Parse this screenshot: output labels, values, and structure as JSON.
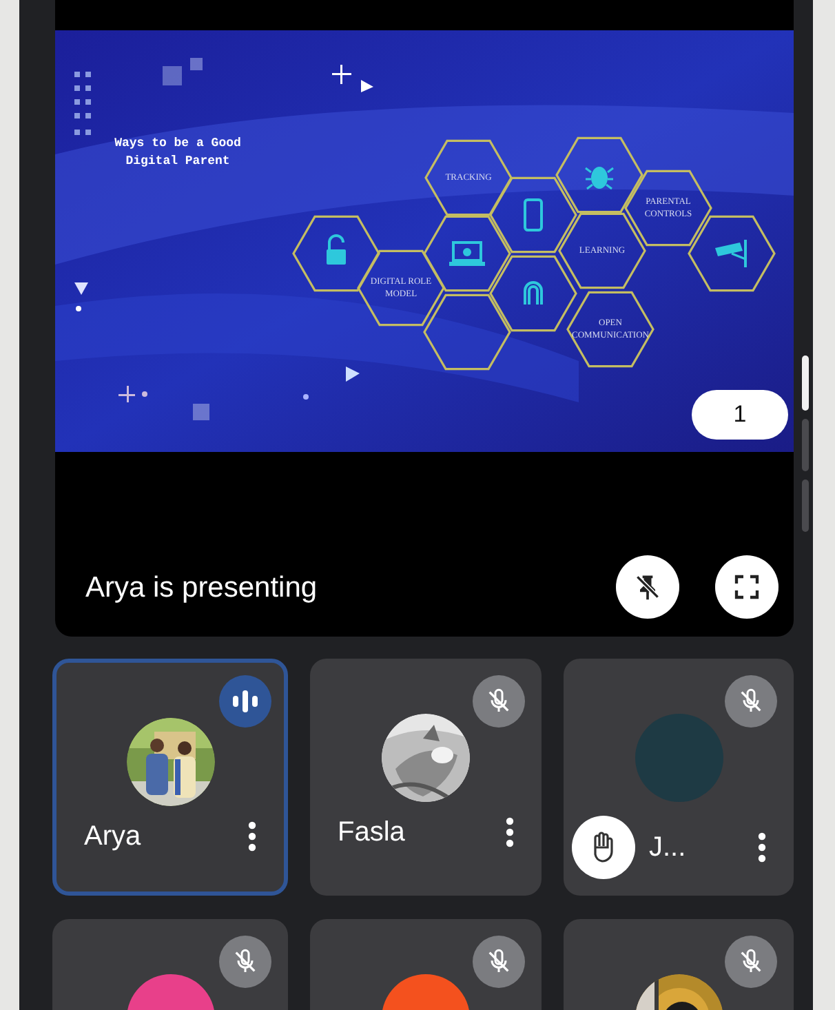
{
  "presentation": {
    "slide": {
      "title": "Ways to be a Good Digital Parent",
      "hexagons": [
        {
          "kind": "icon"
        },
        {
          "kind": "text",
          "label": "DIGITAL ROLE MODEL"
        },
        {
          "kind": "text",
          "label": "TRACKING"
        },
        {
          "kind": "icon"
        },
        {
          "kind": "empty"
        },
        {
          "kind": "icon"
        },
        {
          "kind": "icon"
        },
        {
          "kind": "icon"
        },
        {
          "kind": "text",
          "label": "LEARNING"
        },
        {
          "kind": "text",
          "label": "OPEN COMMUNICATION"
        },
        {
          "kind": "text",
          "label": "PARENTAL CONTROLS"
        },
        {
          "kind": "icon"
        }
      ]
    },
    "page_number": "1",
    "caption": "Arya is presenting"
  },
  "participants": [
    {
      "name": "Arya",
      "speaking": true,
      "muted": false,
      "raised_hand": false
    },
    {
      "name": "Fasla",
      "speaking": false,
      "muted": true,
      "raised_hand": false
    },
    {
      "name": "J...",
      "speaking": false,
      "muted": true,
      "raised_hand": true,
      "avatar": {
        "kind": "color",
        "color": "#1e3a44"
      }
    },
    {
      "speaking": false,
      "muted": true,
      "raised_hand": false,
      "avatar": {
        "kind": "color",
        "color": "#e8408a"
      }
    },
    {
      "speaking": false,
      "muted": true,
      "raised_hand": false,
      "avatar": {
        "kind": "color",
        "color": "#f4511e"
      }
    },
    {
      "speaking": false,
      "muted": true,
      "raised_hand": false
    }
  ]
}
